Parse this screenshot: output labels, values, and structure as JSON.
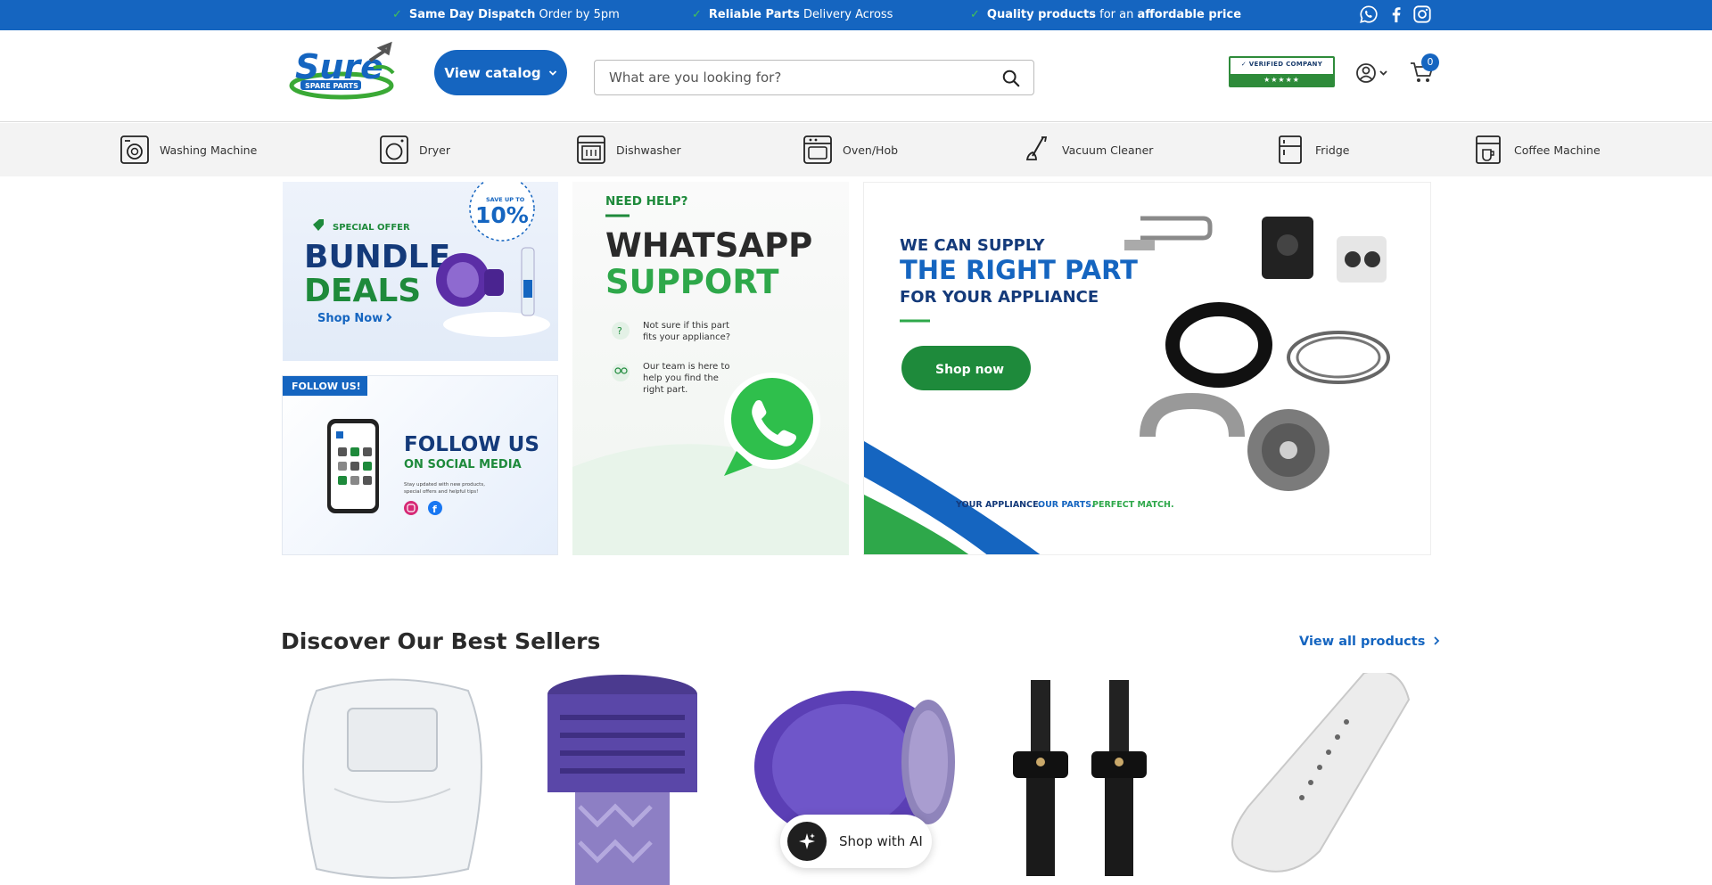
{
  "topbar": {
    "announcements": [
      {
        "bold": "Same Day Dispatch",
        "rest": "Order by 5pm"
      },
      {
        "bold": "Reliable Parts",
        "rest": "Delivery Across"
      },
      {
        "bold": "Quality products",
        "rest": "for an",
        "bold2": "affordable price"
      }
    ],
    "social_icons": [
      "whatsapp-icon",
      "facebook-icon",
      "instagram-icon"
    ],
    "bg_color": "#1565c0"
  },
  "header": {
    "logo_text": "Sure",
    "logo_sub": "SPARE PARTS",
    "catalog_label": "View catalog",
    "search_placeholder": "What are you looking for?",
    "verified_label": "✓ VERIFIED COMPANY",
    "verified_stars": "★★★★★",
    "cart_count": "0"
  },
  "categories": [
    {
      "label": "Washing Machine",
      "icon": "washing-machine-icon"
    },
    {
      "label": "Dryer",
      "icon": "dryer-icon"
    },
    {
      "label": "Dishwasher",
      "icon": "dishwasher-icon"
    },
    {
      "label": "Oven/Hob",
      "icon": "oven-icon"
    },
    {
      "label": "Vacuum Cleaner",
      "icon": "vacuum-icon"
    },
    {
      "label": "Fridge",
      "icon": "fridge-icon"
    },
    {
      "label": "Coffee Machine",
      "icon": "coffee-machine-icon"
    }
  ],
  "banners": {
    "bundle": {
      "badge": "SPECIAL OFFER",
      "save_top": "SAVE UP TO",
      "save_pct": "10%",
      "line1": "BUNDLE",
      "line2": "DEALS",
      "cta": "Shop Now"
    },
    "follow": {
      "tag": "FOLLOW US!",
      "line1": "FOLLOW US",
      "line2": "ON SOCIAL MEDIA",
      "small1": "Stay updated with new products,",
      "small2": "special offers and helpful tips!"
    },
    "whatsapp": {
      "need": "NEED HELP?",
      "line1": "WHATSAPP",
      "line2": "SUPPORT",
      "p1a": "Not sure if this part",
      "p1b": "fits your appliance?",
      "p2a": "Our team is here to",
      "p2b": "help you find the",
      "p2c": "right part."
    },
    "supply": {
      "line1": "WE CAN SUPPLY",
      "line2": "THE RIGHT PART",
      "line3": "FOR YOUR APPLIANCE",
      "cta": "Shop now",
      "tag_a": "YOUR APPLIANCE.",
      "tag_b": "OUR PARTS.",
      "tag_c": "PERFECT MATCH."
    }
  },
  "best_sellers": {
    "title": "Discover Our Best Sellers",
    "view_all": "View all products"
  },
  "shop_ai": {
    "label": "Shop with AI"
  }
}
